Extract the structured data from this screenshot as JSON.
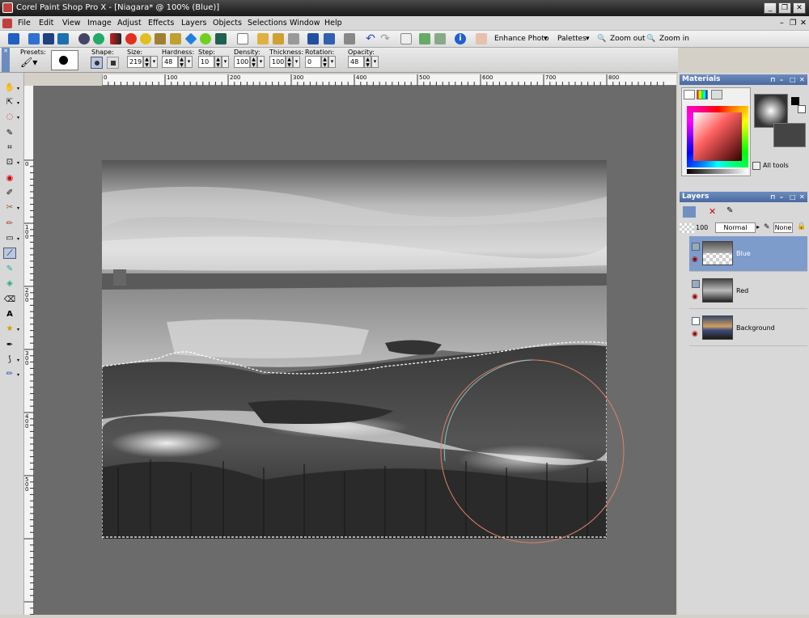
{
  "window": {
    "title": "Corel Paint Shop Pro X - [Niagara* @ 100% (Blue)]",
    "minimize": "_",
    "restore": "❐",
    "close": "✕"
  },
  "menu": [
    "File",
    "Edit",
    "View",
    "Image",
    "Adjust",
    "Effects",
    "Layers",
    "Objects",
    "Selections",
    "Window",
    "Help"
  ],
  "toolbar": {
    "enhance_photo": "Enhance Photo",
    "palettes": "Palettes",
    "zoom_out": "Zoom out",
    "zoom_in": "Zoom in"
  },
  "options": {
    "presets_label": "Presets:",
    "shape_label": "Shape:",
    "size_label": "Size:",
    "size_value": "219",
    "hardness_label": "Hardness:",
    "hardness_value": "48",
    "step_label": "Step:",
    "step_value": "10",
    "density_label": "Density:",
    "density_value": "100",
    "thickness_label": "Thickness:",
    "thickness_value": "100",
    "rotation_label": "Rotation:",
    "rotation_value": "0",
    "opacity_label": "Opacity:",
    "opacity_value": "48"
  },
  "ruler": {
    "h_ticks": [
      "0",
      "100",
      "200",
      "300",
      "400",
      "500",
      "600",
      "700",
      "800"
    ],
    "v_ticks": [
      "0",
      "100",
      "200",
      "300",
      "400",
      "500"
    ]
  },
  "materials": {
    "title": "Materials",
    "all_tools": "All tools"
  },
  "layers": {
    "title": "Layers",
    "opacity": "100",
    "blend_mode": "Normal",
    "mask": "None",
    "items": [
      {
        "name": "Blue",
        "selected": true
      },
      {
        "name": "Red",
        "selected": false
      },
      {
        "name": "Background",
        "selected": false
      }
    ]
  },
  "colors": {
    "accent": "#6c8cbf",
    "workspace": "#6b6b6b",
    "layer_selected": "#7d9ccb"
  }
}
